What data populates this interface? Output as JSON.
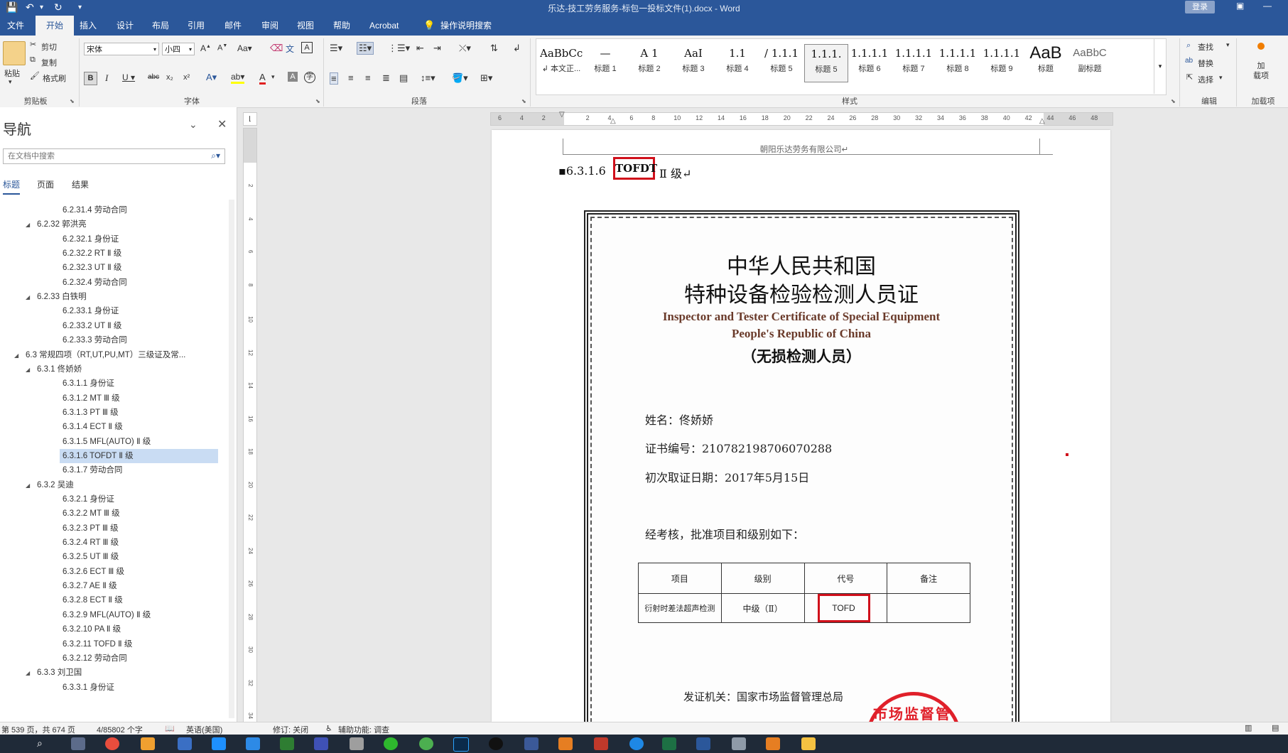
{
  "window": {
    "title": "乐达-技工劳务服务-标包一投标文件(1).docx  -  Word",
    "login_label": "登录"
  },
  "tabs": [
    "文件",
    "开始",
    "插入",
    "设计",
    "布局",
    "引用",
    "邮件",
    "审阅",
    "视图",
    "帮助",
    "Acrobat"
  ],
  "tell_me": "操作说明搜索",
  "ribbon": {
    "clipboard": {
      "paste": "粘贴",
      "cut": "剪切",
      "copy": "复制",
      "format_painter": "格式刷",
      "label": "剪贴板"
    },
    "font": {
      "family": "宋体",
      "size": "小四",
      "label": "字体"
    },
    "paragraph": {
      "label": "段落"
    },
    "styles": {
      "label": "样式",
      "items": [
        {
          "sample": "AaBbCcDdI",
          "name": "↲ 本文正..."
        },
        {
          "sample": "—",
          "name": "标题 1"
        },
        {
          "sample": "A 1",
          "name": "标题 2"
        },
        {
          "sample": "AaI",
          "name": "标题 3"
        },
        {
          "sample": "1.1",
          "name": "标题 4"
        },
        {
          "sample": "/ 1.1.1",
          "name": "标题 5"
        },
        {
          "sample": "1.1.1.",
          "name": "标题 5"
        },
        {
          "sample": "1.1.1.1",
          "name": "标题 6"
        },
        {
          "sample": "1.1.1.1",
          "name": "标题 7"
        },
        {
          "sample": "1.1.1.1",
          "name": "标题 8"
        },
        {
          "sample": "1.1.1.1",
          "name": "标题 9"
        },
        {
          "sample": "AaB",
          "name": "标题"
        },
        {
          "sample": "AaBbC",
          "name": "副标题"
        }
      ]
    },
    "editing": {
      "find": "查找",
      "replace": "替换",
      "select": "选择",
      "label": "编辑"
    },
    "addins": {
      "addin": "加\n载项",
      "label": "加载项"
    }
  },
  "nav": {
    "title": "导航",
    "search_placeholder": "在文档中搜索",
    "tabs": [
      "标题",
      "页面",
      "结果"
    ],
    "items": [
      {
        "level": 3,
        "text": "6.2.31.4 劳动合同"
      },
      {
        "level": 2,
        "text": "6.2.32 郭洪亮",
        "tri": "◢"
      },
      {
        "level": 3,
        "text": "6.2.32.1 身份证"
      },
      {
        "level": 3,
        "text": "6.2.32.2 RT Ⅱ 级"
      },
      {
        "level": 3,
        "text": "6.2.32.3 UT Ⅱ 级"
      },
      {
        "level": 3,
        "text": "6.2.32.4 劳动合同"
      },
      {
        "level": 2,
        "text": "6.2.33 白铁明",
        "tri": "◢"
      },
      {
        "level": 3,
        "text": "6.2.33.1 身份证"
      },
      {
        "level": 3,
        "text": "6.2.33.2 UT Ⅱ 级"
      },
      {
        "level": 3,
        "text": "6.2.33.3 劳动合同"
      },
      {
        "level": 1,
        "text": "6.3 常规四项（RT,UT,PU,MT）三级证及常...",
        "tri": "◢"
      },
      {
        "level": 2,
        "text": "6.3.1 佟娇娇",
        "tri": "◢"
      },
      {
        "level": 3,
        "text": "6.3.1.1 身份证"
      },
      {
        "level": 3,
        "text": "6.3.1.2 MT Ⅲ 级"
      },
      {
        "level": 3,
        "text": "6.3.1.3 PT Ⅲ 级"
      },
      {
        "level": 3,
        "text": "6.3.1.4 ECT Ⅱ 级"
      },
      {
        "level": 3,
        "text": "6.3.1.5 MFL(AUTO) Ⅱ 级"
      },
      {
        "level": 3,
        "text": "6.3.1.6 TOFDT Ⅱ 级",
        "selected": true
      },
      {
        "level": 3,
        "text": "6.3.1.7 劳动合同"
      },
      {
        "level": 2,
        "text": "6.3.2 吴迪",
        "tri": "◢"
      },
      {
        "level": 3,
        "text": "6.3.2.1 身份证"
      },
      {
        "level": 3,
        "text": "6.3.2.2 MT Ⅲ 级"
      },
      {
        "level": 3,
        "text": "6.3.2.3 PT Ⅲ 级"
      },
      {
        "level": 3,
        "text": "6.3.2.4 RT Ⅲ 级"
      },
      {
        "level": 3,
        "text": "6.3.2.5 UT Ⅲ 级"
      },
      {
        "level": 3,
        "text": "6.3.2.6 ECT Ⅲ 级"
      },
      {
        "level": 3,
        "text": "6.3.2.7 AE Ⅱ 级"
      },
      {
        "level": 3,
        "text": "6.3.2.8 ECT Ⅱ 级"
      },
      {
        "level": 3,
        "text": "6.3.2.9 MFL(AUTO) Ⅱ 级"
      },
      {
        "level": 3,
        "text": "6.3.2.10 PA Ⅱ 级"
      },
      {
        "level": 3,
        "text": "6.3.2.11 TOFD Ⅱ 级"
      },
      {
        "level": 3,
        "text": "6.3.2.12 劳动合同"
      },
      {
        "level": 2,
        "text": "6.3.3 刘卫国",
        "tri": "◢"
      },
      {
        "level": 3,
        "text": "6.3.3.1 身份证"
      }
    ]
  },
  "ruler": {
    "ticks": [
      "6",
      "4",
      "2",
      "",
      "2",
      "4",
      "6",
      "8",
      "10",
      "12",
      "14",
      "16",
      "18",
      "20",
      "22",
      "24",
      "26",
      "28",
      "30",
      "32",
      "34",
      "36",
      "38",
      "40",
      "42",
      "44",
      "46",
      "48"
    ]
  },
  "vruler_ticks": [
    "2",
    "4",
    "6",
    "8",
    "10",
    "12",
    "14",
    "16",
    "18",
    "20",
    "22",
    "24",
    "26",
    "28",
    "30",
    "32",
    "34"
  ],
  "document": {
    "header": "朝阳乐达劳务有限公司↵",
    "heading_prefix": "6.3.1.6",
    "heading_highlight": "TOFDT",
    "heading_suffix": "Ⅱ 级↵",
    "certificate": {
      "title1": "中华人民共和国",
      "title2": "特种设备检验检测人员证",
      "en1": "Inspector and Tester Certificate of Special Equipment",
      "en2": "People's Republic of China",
      "subtitle": "（无损检测人员）",
      "name": "姓名：佟娇娇",
      "cert_no": "证书编号：210782198706070288",
      "first_date": "初次取证日期：2017年5月15日",
      "approval": "经考核，批准项目和级别如下：",
      "table_headers": [
        "项目",
        "级别",
        "代号",
        "备注"
      ],
      "table_row": [
        "衍射时差法超声检测",
        "中级（Ⅱ）",
        "TOFD",
        ""
      ],
      "issuer": "发证机关：国家市场监督管理总局",
      "stamp_text": "市场监督管理"
    }
  },
  "status": {
    "page": "第 539 页，共 674 页",
    "words": "4/85802 个字",
    "lang": "英语(美国)",
    "track": "修订: 关闭",
    "access": "辅助功能: 调查"
  },
  "colors": {
    "brand": "#2b579a",
    "highlight_box": "#d0101b",
    "nav_selected": "#c9dcf3"
  }
}
